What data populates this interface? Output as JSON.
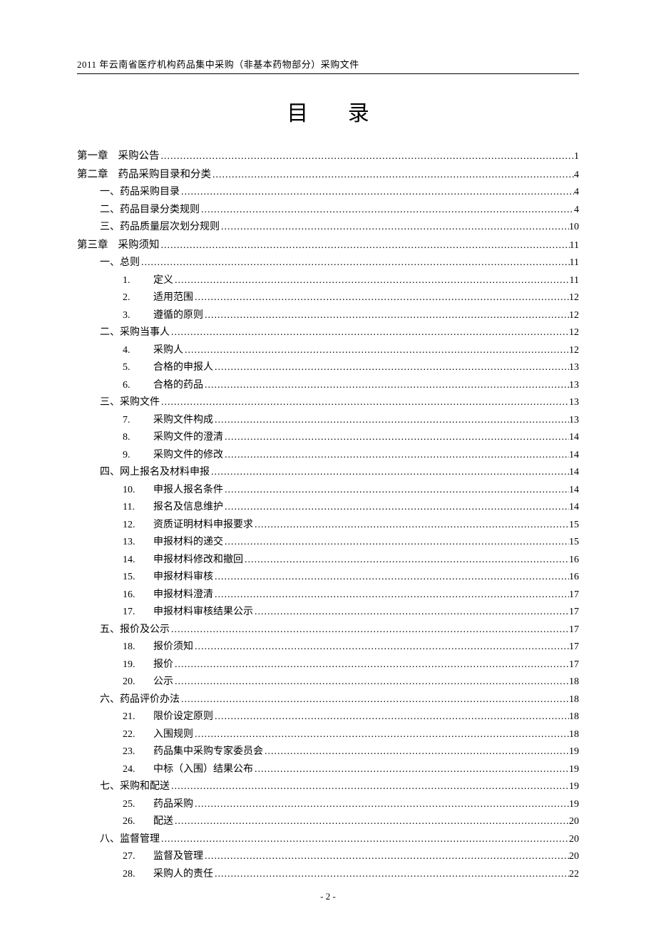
{
  "header": "2011 年云南省医疗机构药品集中采购（非基本药物部分）采购文件",
  "title": "目 录",
  "page_number": "- 2 -",
  "dots": "..............................................................................................................................................................................................................",
  "entries": [
    {
      "level": 1,
      "chapter": "第一章",
      "label": "采购公告",
      "page": "1"
    },
    {
      "level": 1,
      "chapter": "第二章",
      "label": "药品采购目录和分类",
      "page": "4"
    },
    {
      "level": 2,
      "label": "一、药品采购目录",
      "page": "4"
    },
    {
      "level": 2,
      "label": "二、药品目录分类规则",
      "page": "4"
    },
    {
      "level": 2,
      "label": "三、药品质量层次划分规则",
      "page": "10"
    },
    {
      "level": 1,
      "chapter": "第三章",
      "label": "采购须知",
      "page": "11"
    },
    {
      "level": 2,
      "label": "一、总则",
      "page": "11"
    },
    {
      "level": 3,
      "num": "1.",
      "label": "定义",
      "page": "11"
    },
    {
      "level": 3,
      "num": "2.",
      "label": "适用范围",
      "page": "12"
    },
    {
      "level": 3,
      "num": "3.",
      "label": "遵循的原则",
      "page": "12"
    },
    {
      "level": 2,
      "label": "二、采购当事人",
      "page": "12"
    },
    {
      "level": 3,
      "num": "4.",
      "label": "采购人",
      "page": "12"
    },
    {
      "level": 3,
      "num": "5.",
      "label": "合格的申报人",
      "page": "13"
    },
    {
      "level": 3,
      "num": "6.",
      "label": "合格的药品",
      "page": "13"
    },
    {
      "level": 2,
      "label": "三、采购文件",
      "page": "13"
    },
    {
      "level": 3,
      "num": "7.",
      "label": "采购文件构成",
      "page": "13"
    },
    {
      "level": 3,
      "num": "8.",
      "label": "采购文件的澄清",
      "page": "14"
    },
    {
      "level": 3,
      "num": "9.",
      "label": "采购文件的修改",
      "page": "14"
    },
    {
      "level": 2,
      "label": "四、网上报名及材料申报",
      "page": "14"
    },
    {
      "level": 3,
      "num": "10.",
      "label": "申报人报名条件",
      "page": "14"
    },
    {
      "level": 3,
      "num": "11.",
      "label": "报名及信息维护",
      "page": "14"
    },
    {
      "level": 3,
      "num": "12.",
      "label": "资质证明材料申报要求",
      "page": "15"
    },
    {
      "level": 3,
      "num": "13.",
      "label": "申报材料的递交",
      "page": "15"
    },
    {
      "level": 3,
      "num": "14.",
      "label": "申报材料修改和撤回",
      "page": "16"
    },
    {
      "level": 3,
      "num": "15.",
      "label": "申报材料审核",
      "page": "16"
    },
    {
      "level": 3,
      "num": "16.",
      "label": "申报材料澄清",
      "page": "17"
    },
    {
      "level": 3,
      "num": "17.",
      "label": "申报材料审核结果公示",
      "page": "17"
    },
    {
      "level": 2,
      "label": "五、报价及公示",
      "page": "17"
    },
    {
      "level": 3,
      "num": "18.",
      "label": "报价须知",
      "page": "17"
    },
    {
      "level": 3,
      "num": "19.",
      "label": "报价",
      "page": "17"
    },
    {
      "level": 3,
      "num": "20.",
      "label": "公示",
      "page": "18"
    },
    {
      "level": 2,
      "label": "六、药品评价办法",
      "page": "18"
    },
    {
      "level": 3,
      "num": "21.",
      "label": "限价设定原则",
      "page": "18"
    },
    {
      "level": 3,
      "num": "22.",
      "label": "入围规则",
      "page": "18"
    },
    {
      "level": 3,
      "num": "23.",
      "label": "药品集中采购专家委员会",
      "page": "19"
    },
    {
      "level": 3,
      "num": "24.",
      "label": "中标（入围）结果公布",
      "page": "19"
    },
    {
      "level": 2,
      "label": "七、采购和配送",
      "page": "19"
    },
    {
      "level": 3,
      "num": "25.",
      "label": "药品采购",
      "page": "19"
    },
    {
      "level": 3,
      "num": "26.",
      "label": "配送",
      "page": "20"
    },
    {
      "level": 2,
      "label": "八、监督管理",
      "page": "20"
    },
    {
      "level": 3,
      "num": "27.",
      "label": "监督及管理",
      "page": "20"
    },
    {
      "level": 3,
      "num": "28.",
      "label": "采购人的责任",
      "page": "22"
    }
  ]
}
